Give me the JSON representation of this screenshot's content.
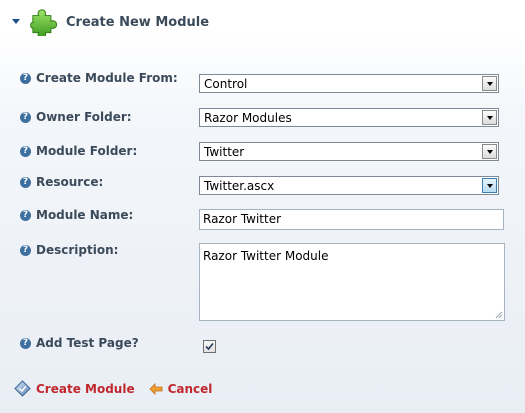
{
  "header": {
    "title": "Create New Module",
    "icon": "puzzle-piece-icon"
  },
  "form": {
    "create_from": {
      "label": "Create Module From:",
      "value": "Control"
    },
    "owner_folder": {
      "label": "Owner Folder:",
      "value": "Razor Modules"
    },
    "module_folder": {
      "label": "Module Folder:",
      "value": "Twitter"
    },
    "resource": {
      "label": "Resource:",
      "value": "Twitter.ascx"
    },
    "module_name": {
      "label": "Module Name:",
      "value": "Razor Twitter"
    },
    "description": {
      "label": "Description:",
      "value": "Razor Twitter Module"
    },
    "add_test_page": {
      "label": "Add Test Page?",
      "checked": true
    },
    "help_glyph": "?"
  },
  "actions": {
    "create_label": "Create Module",
    "cancel_label": "Cancel"
  },
  "colors": {
    "accent_link": "#c0282d",
    "label_text": "#3b4a5a",
    "help_icon": "#3d6f9f",
    "puzzle_green": "#5cb531"
  }
}
